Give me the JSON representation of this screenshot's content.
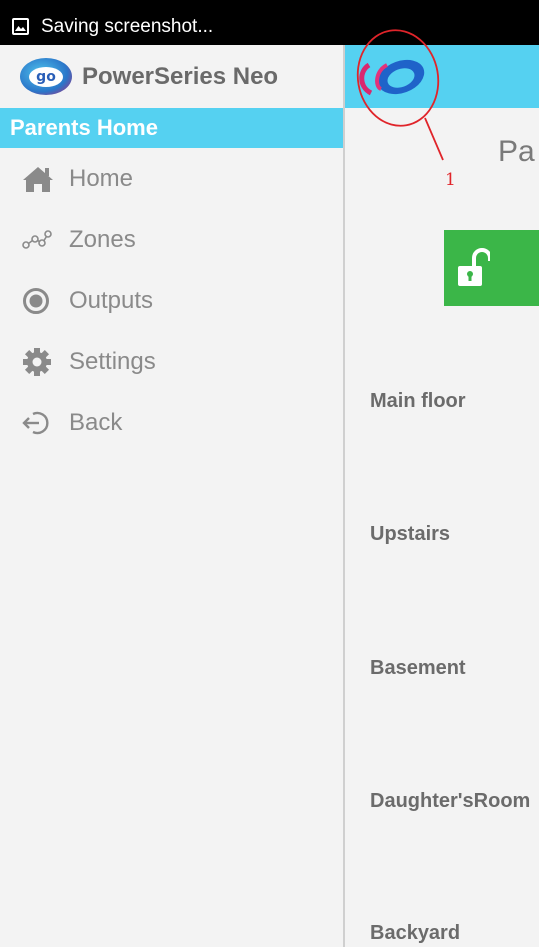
{
  "status_bar": {
    "text": "Saving screenshot..."
  },
  "drawer": {
    "app_title": "PowerSeries Neo",
    "logo_text": "go",
    "section_header": "Parents Home",
    "items": [
      {
        "label": "Home",
        "icon": "home-icon"
      },
      {
        "label": "Zones",
        "icon": "zones-icon"
      },
      {
        "label": "Outputs",
        "icon": "outputs-icon"
      },
      {
        "label": "Settings",
        "icon": "gear-icon"
      },
      {
        "label": "Back",
        "icon": "back-icon"
      }
    ]
  },
  "main": {
    "page_title": "Pa",
    "disarm_icon": "unlocked-padlock-icon",
    "zones": [
      {
        "label": "Main floor"
      },
      {
        "label": "Upstairs"
      },
      {
        "label": "Basement"
      },
      {
        "label": "Daughter'sRoom"
      },
      {
        "label": "Backyard"
      }
    ]
  },
  "annotation": {
    "number": "1"
  },
  "colors": {
    "accent": "#55d1f1",
    "disarm_green": "#3bb648",
    "annotation_red": "#e0242a",
    "text_grey": "#8a8a8a"
  }
}
